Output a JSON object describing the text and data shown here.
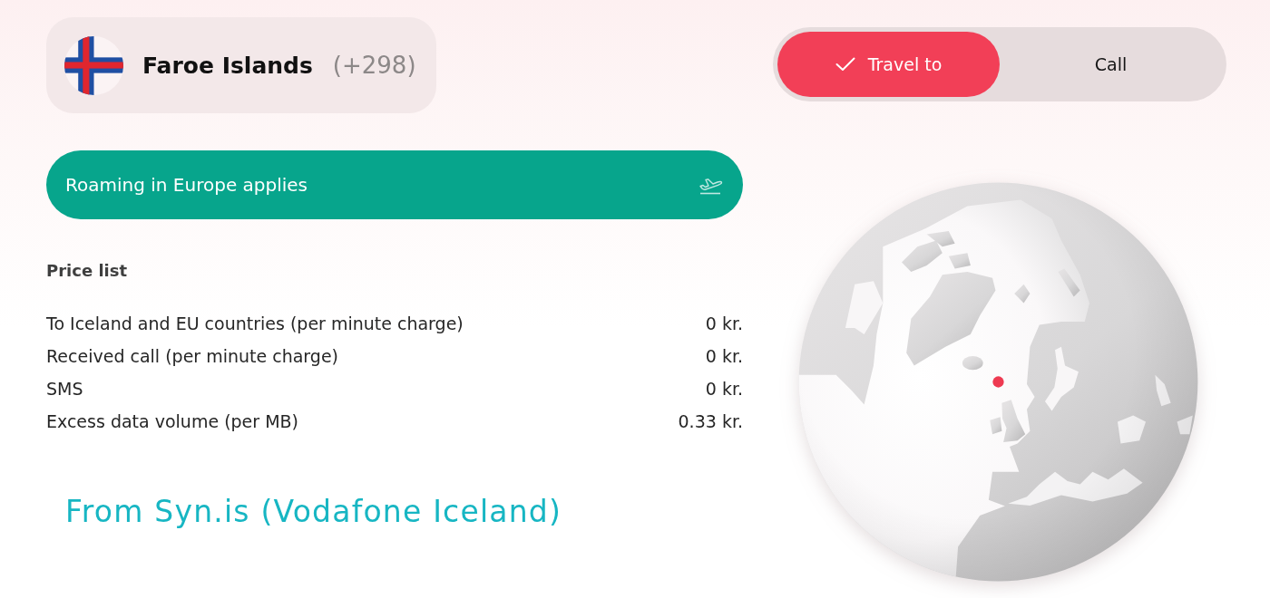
{
  "country": {
    "name": "Faroe Islands",
    "code": "(+298)"
  },
  "mode_tabs": [
    {
      "label": "Travel to",
      "selected": true
    },
    {
      "label": "Call",
      "selected": false
    }
  ],
  "banner": {
    "text": "Roaming in Europe applies"
  },
  "price_list": {
    "title": "Price list",
    "rows": [
      {
        "label": "To Iceland and EU countries (per minute charge)",
        "price": "0 kr."
      },
      {
        "label": "Received call (per minute charge)",
        "price": "0 kr."
      },
      {
        "label": "SMS",
        "price": "0 kr."
      },
      {
        "label": "Excess data volume (per MB)",
        "price": "0.33 kr."
      }
    ]
  },
  "caption": "From Syn.is (Vodafone Iceland)"
}
